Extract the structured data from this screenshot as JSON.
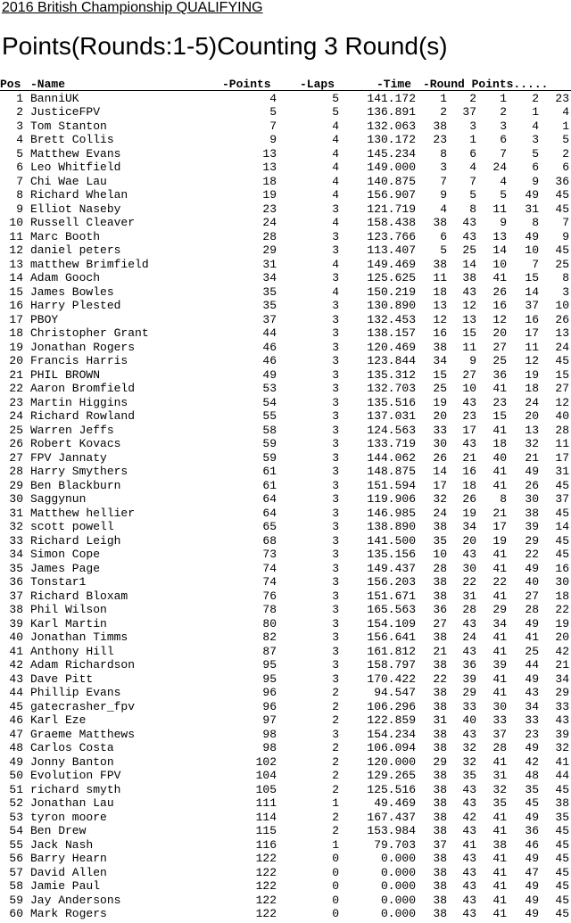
{
  "page": {
    "title": "2016 British Championship QUALIFYING",
    "heading": "Points(Rounds:1-5)Counting 3 Round(s)"
  },
  "table": {
    "headers": {
      "pos": "Pos",
      "name": "-Name",
      "points": "-Points",
      "laps": "-Laps",
      "time": "-Time",
      "round_points": "-Round Points....."
    },
    "rows": [
      [
        "1",
        "BanniUK",
        "4",
        "5",
        "141.172",
        "1",
        "2",
        "1",
        "2",
        "23"
      ],
      [
        "2",
        "JusticeFPV",
        "5",
        "5",
        "136.891",
        "2",
        "37",
        "2",
        "1",
        "4"
      ],
      [
        "3",
        "Tom Stanton",
        "7",
        "4",
        "132.063",
        "38",
        "3",
        "3",
        "4",
        "1"
      ],
      [
        "4",
        "Brett Collis",
        "9",
        "4",
        "130.172",
        "23",
        "1",
        "6",
        "3",
        "5"
      ],
      [
        "5",
        "Matthew Evans",
        "13",
        "4",
        "145.234",
        "8",
        "6",
        "7",
        "5",
        "2"
      ],
      [
        "6",
        "Leo Whitfield",
        "13",
        "4",
        "149.000",
        "3",
        "4",
        "24",
        "6",
        "6"
      ],
      [
        "7",
        "Chi Wae Lau",
        "18",
        "4",
        "140.875",
        "7",
        "7",
        "4",
        "9",
        "36"
      ],
      [
        "8",
        "Richard Whelan",
        "19",
        "4",
        "156.907",
        "9",
        "5",
        "5",
        "49",
        "45"
      ],
      [
        "9",
        "Elliot Naseby",
        "23",
        "3",
        "121.719",
        "4",
        "8",
        "11",
        "31",
        "45"
      ],
      [
        "10",
        "Russell Cleaver",
        "24",
        "4",
        "158.438",
        "38",
        "43",
        "9",
        "8",
        "7"
      ],
      [
        "11",
        "Marc Booth",
        "28",
        "3",
        "123.766",
        "6",
        "43",
        "13",
        "49",
        "9"
      ],
      [
        "12",
        "daniel peters",
        "29",
        "3",
        "113.407",
        "5",
        "25",
        "14",
        "10",
        "45"
      ],
      [
        "13",
        "matthew Brimfield",
        "31",
        "4",
        "149.469",
        "38",
        "14",
        "10",
        "7",
        "25"
      ],
      [
        "14",
        "Adam Gooch",
        "34",
        "3",
        "125.625",
        "11",
        "38",
        "41",
        "15",
        "8"
      ],
      [
        "15",
        "James Bowles",
        "35",
        "4",
        "150.219",
        "18",
        "43",
        "26",
        "14",
        "3"
      ],
      [
        "16",
        "Harry Plested",
        "35",
        "3",
        "130.890",
        "13",
        "12",
        "16",
        "37",
        "10"
      ],
      [
        "17",
        "PBOY",
        "37",
        "3",
        "132.453",
        "12",
        "13",
        "12",
        "16",
        "26"
      ],
      [
        "18",
        "Christopher Grant",
        "44",
        "3",
        "138.157",
        "16",
        "15",
        "20",
        "17",
        "13"
      ],
      [
        "19",
        "Jonathan Rogers",
        "46",
        "3",
        "120.469",
        "38",
        "11",
        "27",
        "11",
        "24"
      ],
      [
        "20",
        "Francis Harris",
        "46",
        "3",
        "123.844",
        "34",
        "9",
        "25",
        "12",
        "45"
      ],
      [
        "21",
        "PHIL BROWN",
        "49",
        "3",
        "135.312",
        "15",
        "27",
        "36",
        "19",
        "15"
      ],
      [
        "22",
        "Aaron Bromfield",
        "53",
        "3",
        "132.703",
        "25",
        "10",
        "41",
        "18",
        "27"
      ],
      [
        "23",
        "Martin Higgins",
        "54",
        "3",
        "135.516",
        "19",
        "43",
        "23",
        "24",
        "12"
      ],
      [
        "24",
        "Richard Rowland",
        "55",
        "3",
        "137.031",
        "20",
        "23",
        "15",
        "20",
        "40"
      ],
      [
        "25",
        "Warren Jeffs",
        "58",
        "3",
        "124.563",
        "33",
        "17",
        "41",
        "13",
        "28"
      ],
      [
        "26",
        "Robert Kovacs",
        "59",
        "3",
        "133.719",
        "30",
        "43",
        "18",
        "32",
        "11"
      ],
      [
        "27",
        "FPV Jannaty",
        "59",
        "3",
        "144.062",
        "26",
        "21",
        "40",
        "21",
        "17"
      ],
      [
        "28",
        "Harry Smythers",
        "61",
        "3",
        "148.875",
        "14",
        "16",
        "41",
        "49",
        "31"
      ],
      [
        "29",
        "Ben Blackburn",
        "61",
        "3",
        "151.594",
        "17",
        "18",
        "41",
        "26",
        "45"
      ],
      [
        "30",
        "Saggynun",
        "64",
        "3",
        "119.906",
        "32",
        "26",
        "8",
        "30",
        "37"
      ],
      [
        "31",
        "Matthew hellier",
        "64",
        "3",
        "146.985",
        "24",
        "19",
        "21",
        "38",
        "45"
      ],
      [
        "32",
        "scott powell",
        "65",
        "3",
        "138.890",
        "38",
        "34",
        "17",
        "39",
        "14"
      ],
      [
        "33",
        "Richard Leigh",
        "68",
        "3",
        "141.500",
        "35",
        "20",
        "19",
        "29",
        "45"
      ],
      [
        "34",
        "Simon Cope",
        "73",
        "3",
        "135.156",
        "10",
        "43",
        "41",
        "22",
        "45"
      ],
      [
        "35",
        "James Page",
        "74",
        "3",
        "149.437",
        "28",
        "30",
        "41",
        "49",
        "16"
      ],
      [
        "36",
        "Tonstar1",
        "74",
        "3",
        "156.203",
        "38",
        "22",
        "22",
        "40",
        "30"
      ],
      [
        "37",
        "Richard Bloxam",
        "76",
        "3",
        "151.671",
        "38",
        "31",
        "41",
        "27",
        "18"
      ],
      [
        "38",
        "Phil Wilson",
        "78",
        "3",
        "165.563",
        "36",
        "28",
        "29",
        "28",
        "22"
      ],
      [
        "39",
        "Karl Martin",
        "80",
        "3",
        "154.109",
        "27",
        "43",
        "34",
        "49",
        "19"
      ],
      [
        "40",
        "Jonathan Timms",
        "82",
        "3",
        "156.641",
        "38",
        "24",
        "41",
        "41",
        "20"
      ],
      [
        "41",
        "Anthony Hill",
        "87",
        "3",
        "161.812",
        "21",
        "43",
        "41",
        "25",
        "42"
      ],
      [
        "42",
        "Adam Richardson",
        "95",
        "3",
        "158.797",
        "38",
        "36",
        "39",
        "44",
        "21"
      ],
      [
        "43",
        "Dave Pitt",
        "95",
        "3",
        "170.422",
        "22",
        "39",
        "41",
        "49",
        "34"
      ],
      [
        "44",
        "Phillip Evans",
        "96",
        "2",
        "94.547",
        "38",
        "29",
        "41",
        "43",
        "29"
      ],
      [
        "45",
        "gatecrasher_fpv",
        "96",
        "2",
        "106.296",
        "38",
        "33",
        "30",
        "34",
        "33"
      ],
      [
        "46",
        "Karl Eze",
        "97",
        "2",
        "122.859",
        "31",
        "40",
        "33",
        "33",
        "43"
      ],
      [
        "47",
        "Graeme Matthews",
        "98",
        "3",
        "154.234",
        "38",
        "43",
        "37",
        "23",
        "39"
      ],
      [
        "48",
        "Carlos Costa",
        "98",
        "2",
        "106.094",
        "38",
        "32",
        "28",
        "49",
        "32"
      ],
      [
        "49",
        "Jonny Banton",
        "102",
        "2",
        "120.000",
        "29",
        "32",
        "41",
        "42",
        "41"
      ],
      [
        "50",
        "Evolution FPV",
        "104",
        "2",
        "129.265",
        "38",
        "35",
        "31",
        "48",
        "44"
      ],
      [
        "51",
        "richard smyth",
        "105",
        "2",
        "125.516",
        "38",
        "43",
        "32",
        "35",
        "45"
      ],
      [
        "52",
        "Jonathan Lau",
        "111",
        "1",
        "49.469",
        "38",
        "43",
        "35",
        "45",
        "38"
      ],
      [
        "53",
        "tyron moore",
        "114",
        "2",
        "167.437",
        "38",
        "42",
        "41",
        "49",
        "35"
      ],
      [
        "54",
        "Ben Drew",
        "115",
        "2",
        "153.984",
        "38",
        "43",
        "41",
        "36",
        "45"
      ],
      [
        "55",
        "Jack Nash",
        "116",
        "1",
        "79.703",
        "37",
        "41",
        "38",
        "46",
        "45"
      ],
      [
        "56",
        "Barry Hearn",
        "122",
        "0",
        "0.000",
        "38",
        "43",
        "41",
        "49",
        "45"
      ],
      [
        "57",
        "David Allen",
        "122",
        "0",
        "0.000",
        "38",
        "43",
        "41",
        "47",
        "45"
      ],
      [
        "58",
        "Jamie Paul",
        "122",
        "0",
        "0.000",
        "38",
        "43",
        "41",
        "49",
        "45"
      ],
      [
        "59",
        "Jay Andersons",
        "122",
        "0",
        "0.000",
        "38",
        "43",
        "41",
        "49",
        "45"
      ],
      [
        "60",
        "Mark Rogers",
        "122",
        "0",
        "0.000",
        "38",
        "43",
        "41",
        "49",
        "45"
      ]
    ]
  }
}
